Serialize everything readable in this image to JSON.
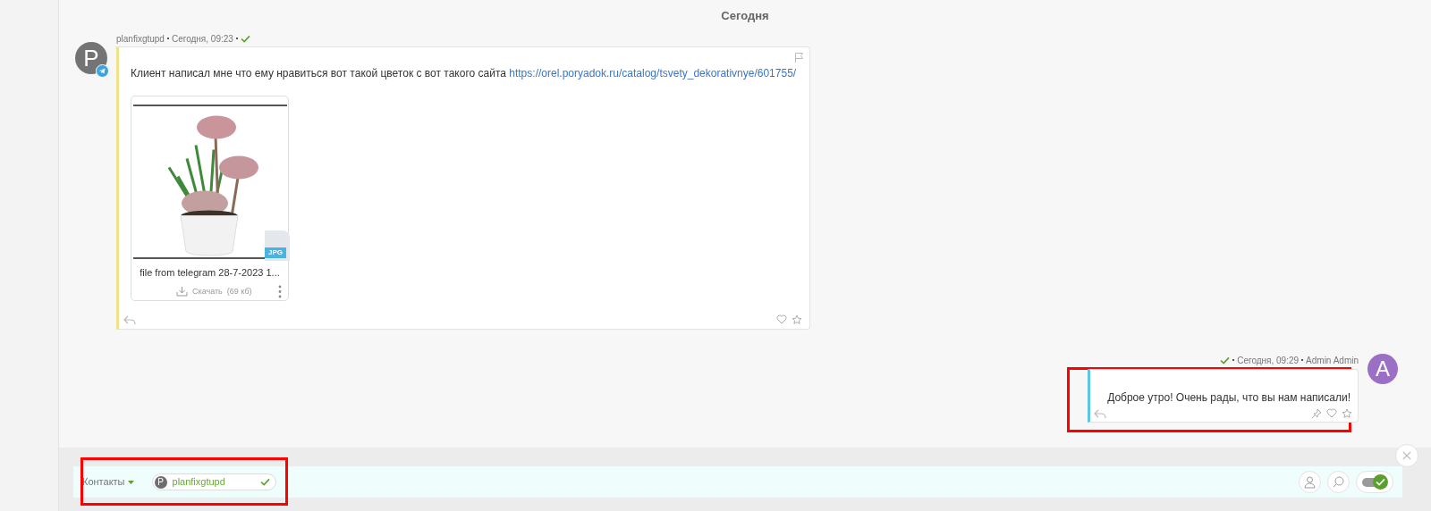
{
  "date_heading": "Сегодня",
  "incoming": [
    {
      "avatar": "P",
      "author": "planfixgtupd",
      "time": "Сегодня, 09:23",
      "delivered": true,
      "via_telegram": true,
      "text": "Клиент написал мне что ему нравиться вот такой цветок с вот такого сайта",
      "link": "https://orel.poryadok.ru/catalog/tsvety_dekorativnye/601755/",
      "attachment": {
        "kind": "picture",
        "type": "JPG",
        "name": "file from telegram 28-7-2023 1...",
        "download": "Скачать",
        "size": "(69 кб)"
      }
    }
  ],
  "outgoing": [
    {
      "avatar": "A",
      "author": "Admin Admin",
      "time": "Сегодня, 09:29",
      "delivered": true,
      "text": "Доброе утро! Очень рады, что вы нам написали!"
    }
  ],
  "contacts_bar": {
    "label": "Контакты",
    "contact": {
      "avatar": "P",
      "name": "planfixgtupd",
      "confirmed": true
    },
    "toggle": {
      "on": true
    }
  }
}
